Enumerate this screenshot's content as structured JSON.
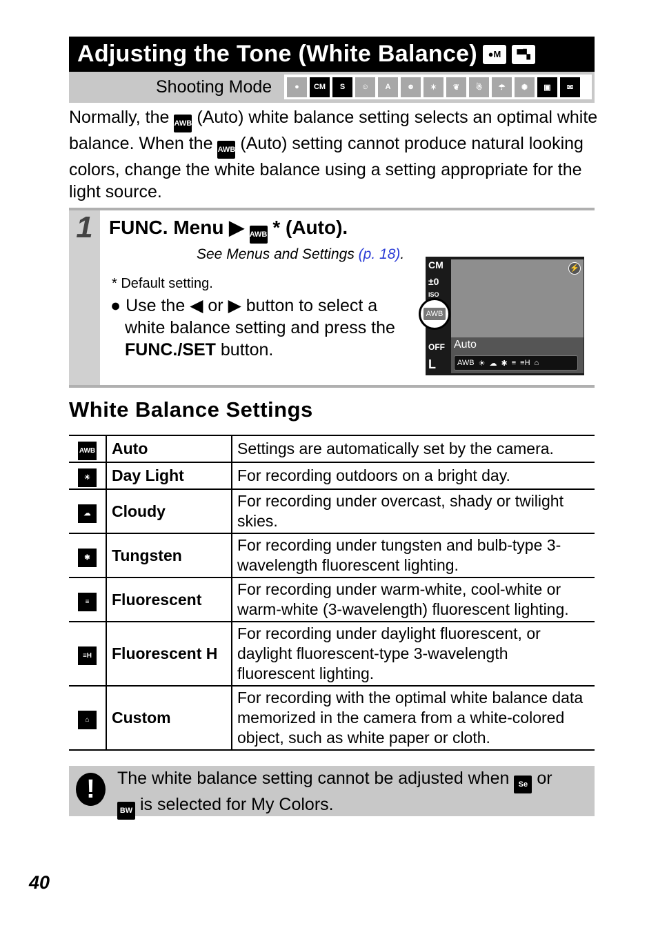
{
  "title": "Adjusting the Tone (White Balance)",
  "title_icons": [
    "camera-m-icon",
    "movie-icon"
  ],
  "shooting_mode_label": "Shooting Mode",
  "shooting_modes": [
    {
      "icon": "auto-camera-icon",
      "dark": false,
      "label": "●"
    },
    {
      "icon": "manual-icon",
      "dark": true,
      "label": "CM"
    },
    {
      "icon": "digital-macro-icon",
      "dark": true,
      "label": "S"
    },
    {
      "icon": "portrait-icon",
      "dark": false,
      "label": "☺"
    },
    {
      "icon": "night-snapshot-icon",
      "dark": false,
      "label": "A"
    },
    {
      "icon": "kids-pets-icon",
      "dark": false,
      "label": "☻"
    },
    {
      "icon": "indoor-icon",
      "dark": false,
      "label": "✶"
    },
    {
      "icon": "foliage-icon",
      "dark": false,
      "label": "❦"
    },
    {
      "icon": "snow-icon",
      "dark": false,
      "label": "☃"
    },
    {
      "icon": "beach-icon",
      "dark": false,
      "label": "☂"
    },
    {
      "icon": "fireworks-icon",
      "dark": false,
      "label": "✺"
    },
    {
      "icon": "movie-icon",
      "dark": true,
      "label": "▣"
    },
    {
      "icon": "movie-email-icon",
      "dark": true,
      "label": "✉"
    }
  ],
  "intro": {
    "p1": "Normally, the",
    "awb": "AWB",
    "p2": "(Auto) white balance setting selects an optimal white balance. When the",
    "p3": "(Auto) setting cannot produce natural looking colors, change the white balance using a setting appropriate for the light source."
  },
  "step": {
    "number": "1",
    "heading_a": "FUNC. Menu",
    "heading_b": "* (Auto).",
    "see_text": "See Menus and Settings",
    "see_link": "(p. 18)",
    "see_end": ".",
    "default_note": "* Default setting.",
    "bullet_a": "Use the",
    "or": "or",
    "bullet_b": "button to select a",
    "bullet_c": "white balance setting and press the",
    "bullet_bold": "FUNC./SET",
    "bullet_d": "button."
  },
  "screen": {
    "mode": "CM",
    "ev": "±0",
    "iso": "ISO",
    "wb": "AWB",
    "label": "Auto",
    "off": "OFF",
    "size": "L",
    "icons": [
      "AWB",
      "☀",
      "☁",
      "✱",
      "≡",
      "≡H",
      "⌂"
    ]
  },
  "section_title": "White Balance Settings",
  "table": [
    {
      "icon": "AWB",
      "name": "Auto",
      "desc": "Settings are automatically set by the camera."
    },
    {
      "icon": "☀",
      "name": "Day Light",
      "desc": "For recording outdoors on a bright day."
    },
    {
      "icon": "☁",
      "name": "Cloudy",
      "desc": "For recording under overcast, shady or twilight skies."
    },
    {
      "icon": "✱",
      "name": "Tungsten",
      "desc": "For recording under tungsten and bulb-type 3-wavelength fluorescent lighting."
    },
    {
      "icon": "≡",
      "name": "Fluorescent",
      "desc": "For recording under warm-white, cool-white or warm-white (3-wavelength) fluorescent lighting."
    },
    {
      "icon": "≡H",
      "name": "Fluorescent H",
      "desc": "For recording under daylight fluorescent, or daylight fluorescent-type 3-wavelength fluorescent lighting."
    },
    {
      "icon": "⌂",
      "name": "Custom",
      "desc": "For recording with the optimal white balance data memorized in the camera from a white-colored object, such as white paper or cloth."
    }
  ],
  "caution": {
    "a": "The white balance setting cannot be adjusted when",
    "icon1": "Se",
    "or": "or",
    "icon2": "BW",
    "b": "is selected for My Colors."
  },
  "page_number": "40"
}
